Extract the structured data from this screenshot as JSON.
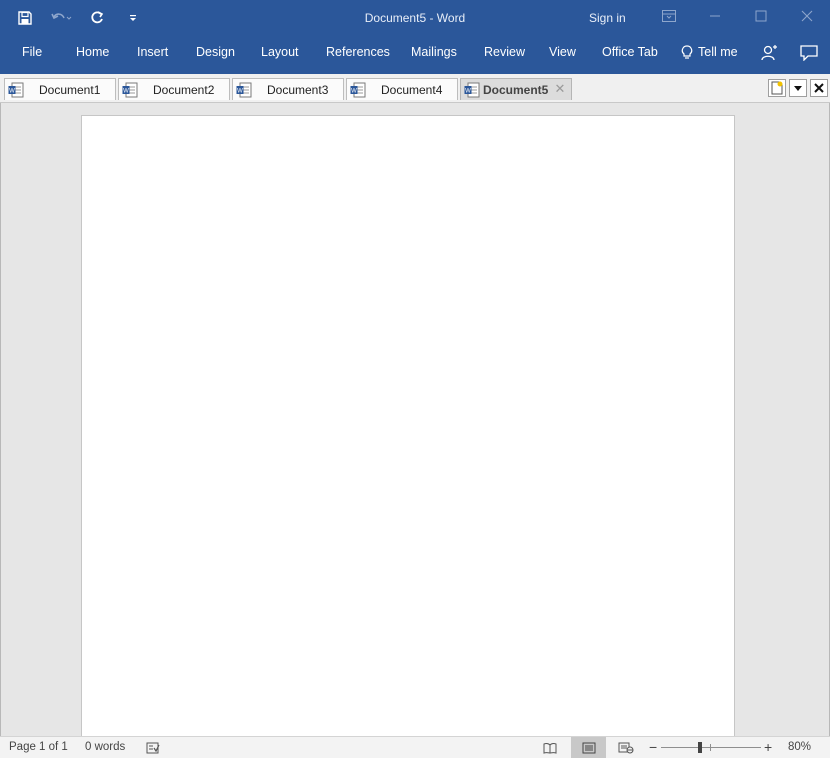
{
  "window": {
    "title": "Document5  -  Word",
    "sign_in": "Sign in"
  },
  "ribbon": {
    "tabs": [
      "File",
      "Home",
      "Insert",
      "Design",
      "Layout",
      "References",
      "Mailings",
      "Review",
      "View",
      "Office Tab"
    ],
    "tell_me": "Tell me"
  },
  "doc_tabs": {
    "tabs": [
      "Document1",
      "Document2",
      "Document3",
      "Document4",
      "Document5"
    ],
    "active_index": 4
  },
  "status": {
    "page": "Page 1 of 1",
    "words": "0 words",
    "zoom": "80%",
    "zoom_level": 0.8
  },
  "colors": {
    "accent": "#2b579a",
    "workspace": "#e6e6e6",
    "page": "#ffffff"
  },
  "icons": {
    "qat": [
      "save-icon",
      "undo-icon",
      "redo-icon",
      "customize-qat-icon"
    ],
    "window_controls": [
      "ribbon-display-options-icon",
      "minimize-icon",
      "maximize-icon",
      "close-icon"
    ],
    "ribbon_right": [
      "lightbulb-icon",
      "share-user-icon",
      "comments-icon"
    ],
    "doc_tab_buttons": [
      "new-document-icon",
      "tab-list-dropdown-icon",
      "close-tab-icon"
    ],
    "status": [
      "proofing-icon",
      "read-mode-icon",
      "print-layout-icon",
      "web-layout-icon",
      "zoom-out-icon",
      "zoom-in-icon"
    ]
  }
}
